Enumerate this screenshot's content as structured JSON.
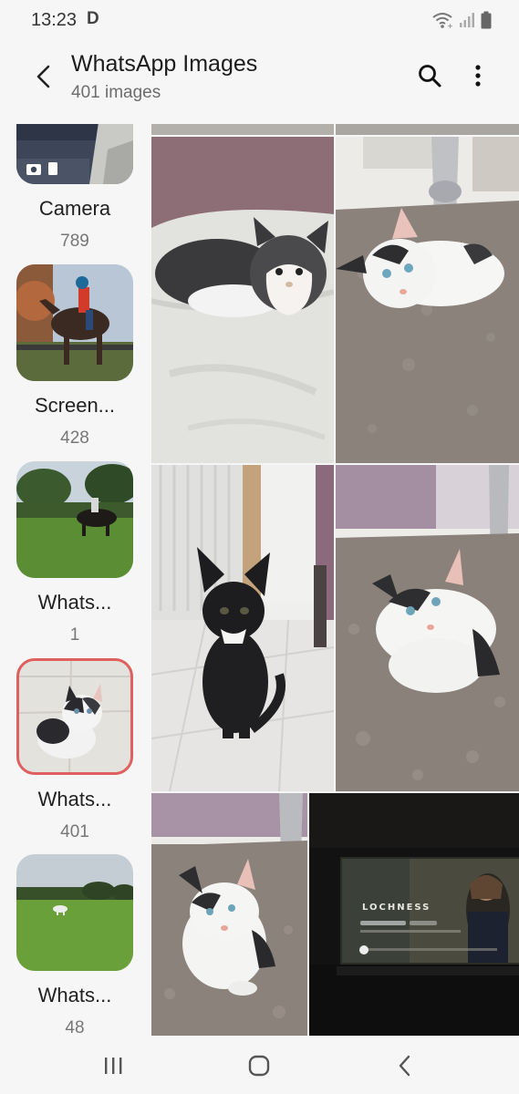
{
  "status": {
    "time": "13:23",
    "notification_letter": "D",
    "icons": [
      "wifi-icon",
      "signal-icon",
      "battery-icon"
    ]
  },
  "header": {
    "title": "WhatsApp Images",
    "subtitle": "401 images",
    "actions": [
      "search-icon",
      "more-options-icon"
    ]
  },
  "albums": [
    {
      "name": "Camera",
      "count": "789",
      "selected": false
    },
    {
      "name": "Screen...",
      "count": "428",
      "selected": false
    },
    {
      "name": "Whats...",
      "count": "1",
      "selected": false
    },
    {
      "name": "Whats...",
      "count": "401",
      "selected": true
    },
    {
      "name": "Whats...",
      "count": "48",
      "selected": false
    }
  ],
  "photos": [
    {
      "subject": "kitten-on-blanket"
    },
    {
      "subject": "kitten-lying-on-carpet"
    },
    {
      "subject": "black-kitten-on-tiles"
    },
    {
      "subject": "kitten-on-carpet"
    },
    {
      "subject": "kitten-sitting-on-carpet"
    },
    {
      "subject": "tv-screen-lochness"
    }
  ],
  "tv_screen": {
    "title": "LOCHNESS"
  },
  "navigation": [
    "recent-apps-icon",
    "home-icon",
    "back-icon"
  ],
  "colors": {
    "background": "#f6f6f6",
    "selected_outline": "#e06060",
    "title_text": "#1c1c1c",
    "secondary_text": "#6d6d6d"
  }
}
